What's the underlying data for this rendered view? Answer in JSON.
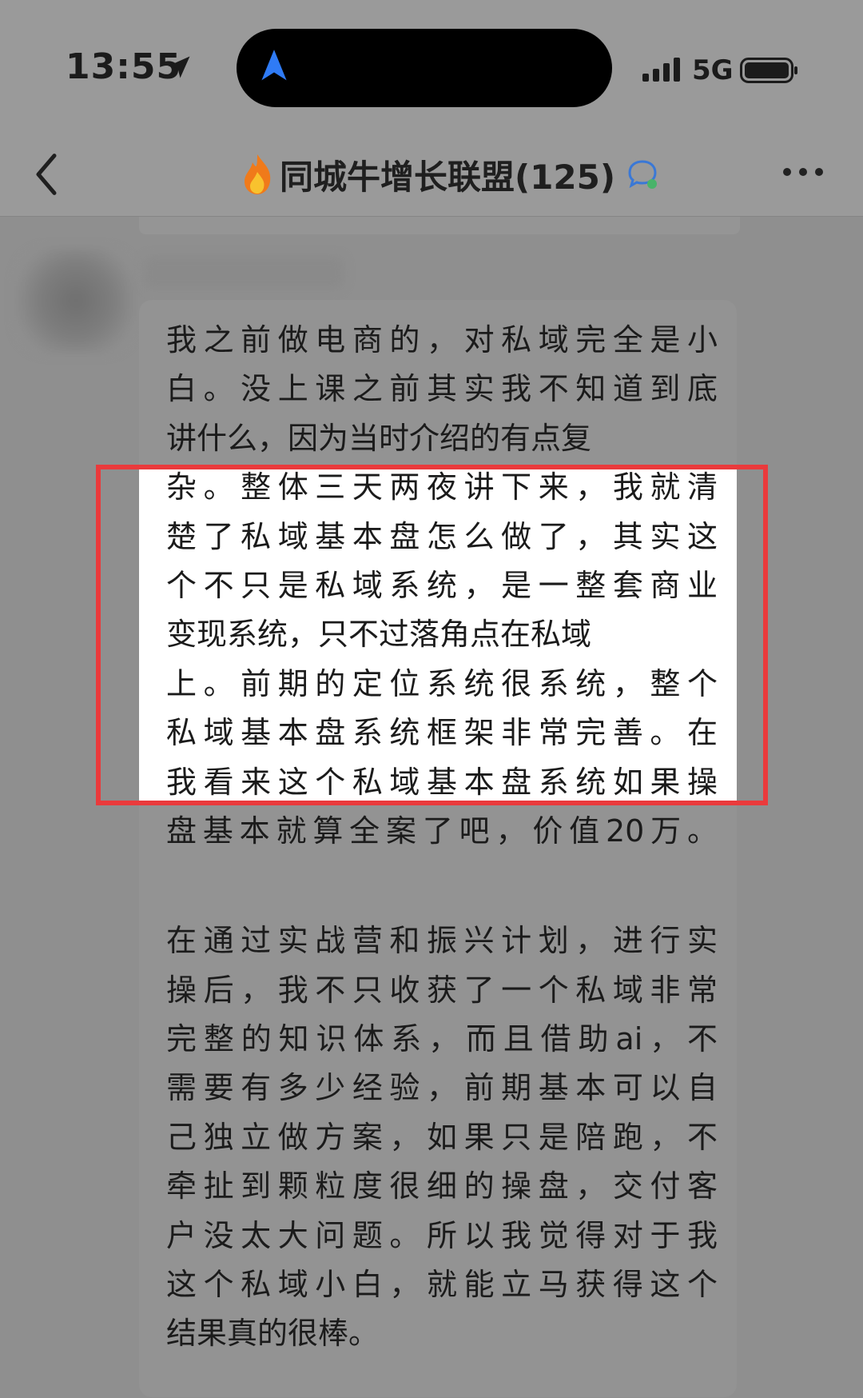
{
  "status_bar": {
    "time": "13:55",
    "network": "5G"
  },
  "nav": {
    "title": "同城牛增长联盟(125)"
  },
  "message": {
    "para1_lines": [
      "我之前做电商的，对私域完全是小",
      "白。没上课之前其实我不知道到底",
      "讲什么，因为当时介绍的有点复"
    ],
    "highlight_lines": [
      "杂。整体三天两夜讲下来，我就清",
      "楚了私域基本盘怎么做了，其实这",
      "个不只是私域系统，是一整套商业",
      "变现系统，只不过落角点在私域",
      "上。前期的定位系统很系统，整个",
      "私域基本盘系统框架非常完善。在",
      "我看来这个私域基本盘系统如果操",
      "盘基本就算全案了吧，价值20万。"
    ],
    "para2_lines": [
      "在通过实战营和振兴计划，进行实",
      "操后，我不只收获了一个私域非常",
      "完整的知识体系，而且借助ai，不",
      "需要有多少经验，前期基本可以自",
      "己独立做方案，如果只是陪跑，不",
      "牵扯到颗粒度很细的操盘，交付客",
      "户没太大问题。所以我觉得对于我",
      "这个私域小白，就能立马获得这个",
      "结果真的很棒。"
    ]
  },
  "icons": {
    "location": "location-arrow-icon",
    "nav_arrow": "navigation-arrow-icon",
    "signal": "cellular-signal-icon",
    "battery": "battery-icon",
    "back": "chevron-left-icon",
    "fire": "fire-emoji-icon",
    "chat": "chat-bubble-icon",
    "more": "more-dots-icon"
  },
  "colors": {
    "highlight_border": "#ea3a3c",
    "nav_arrow": "#2f7bf6"
  }
}
